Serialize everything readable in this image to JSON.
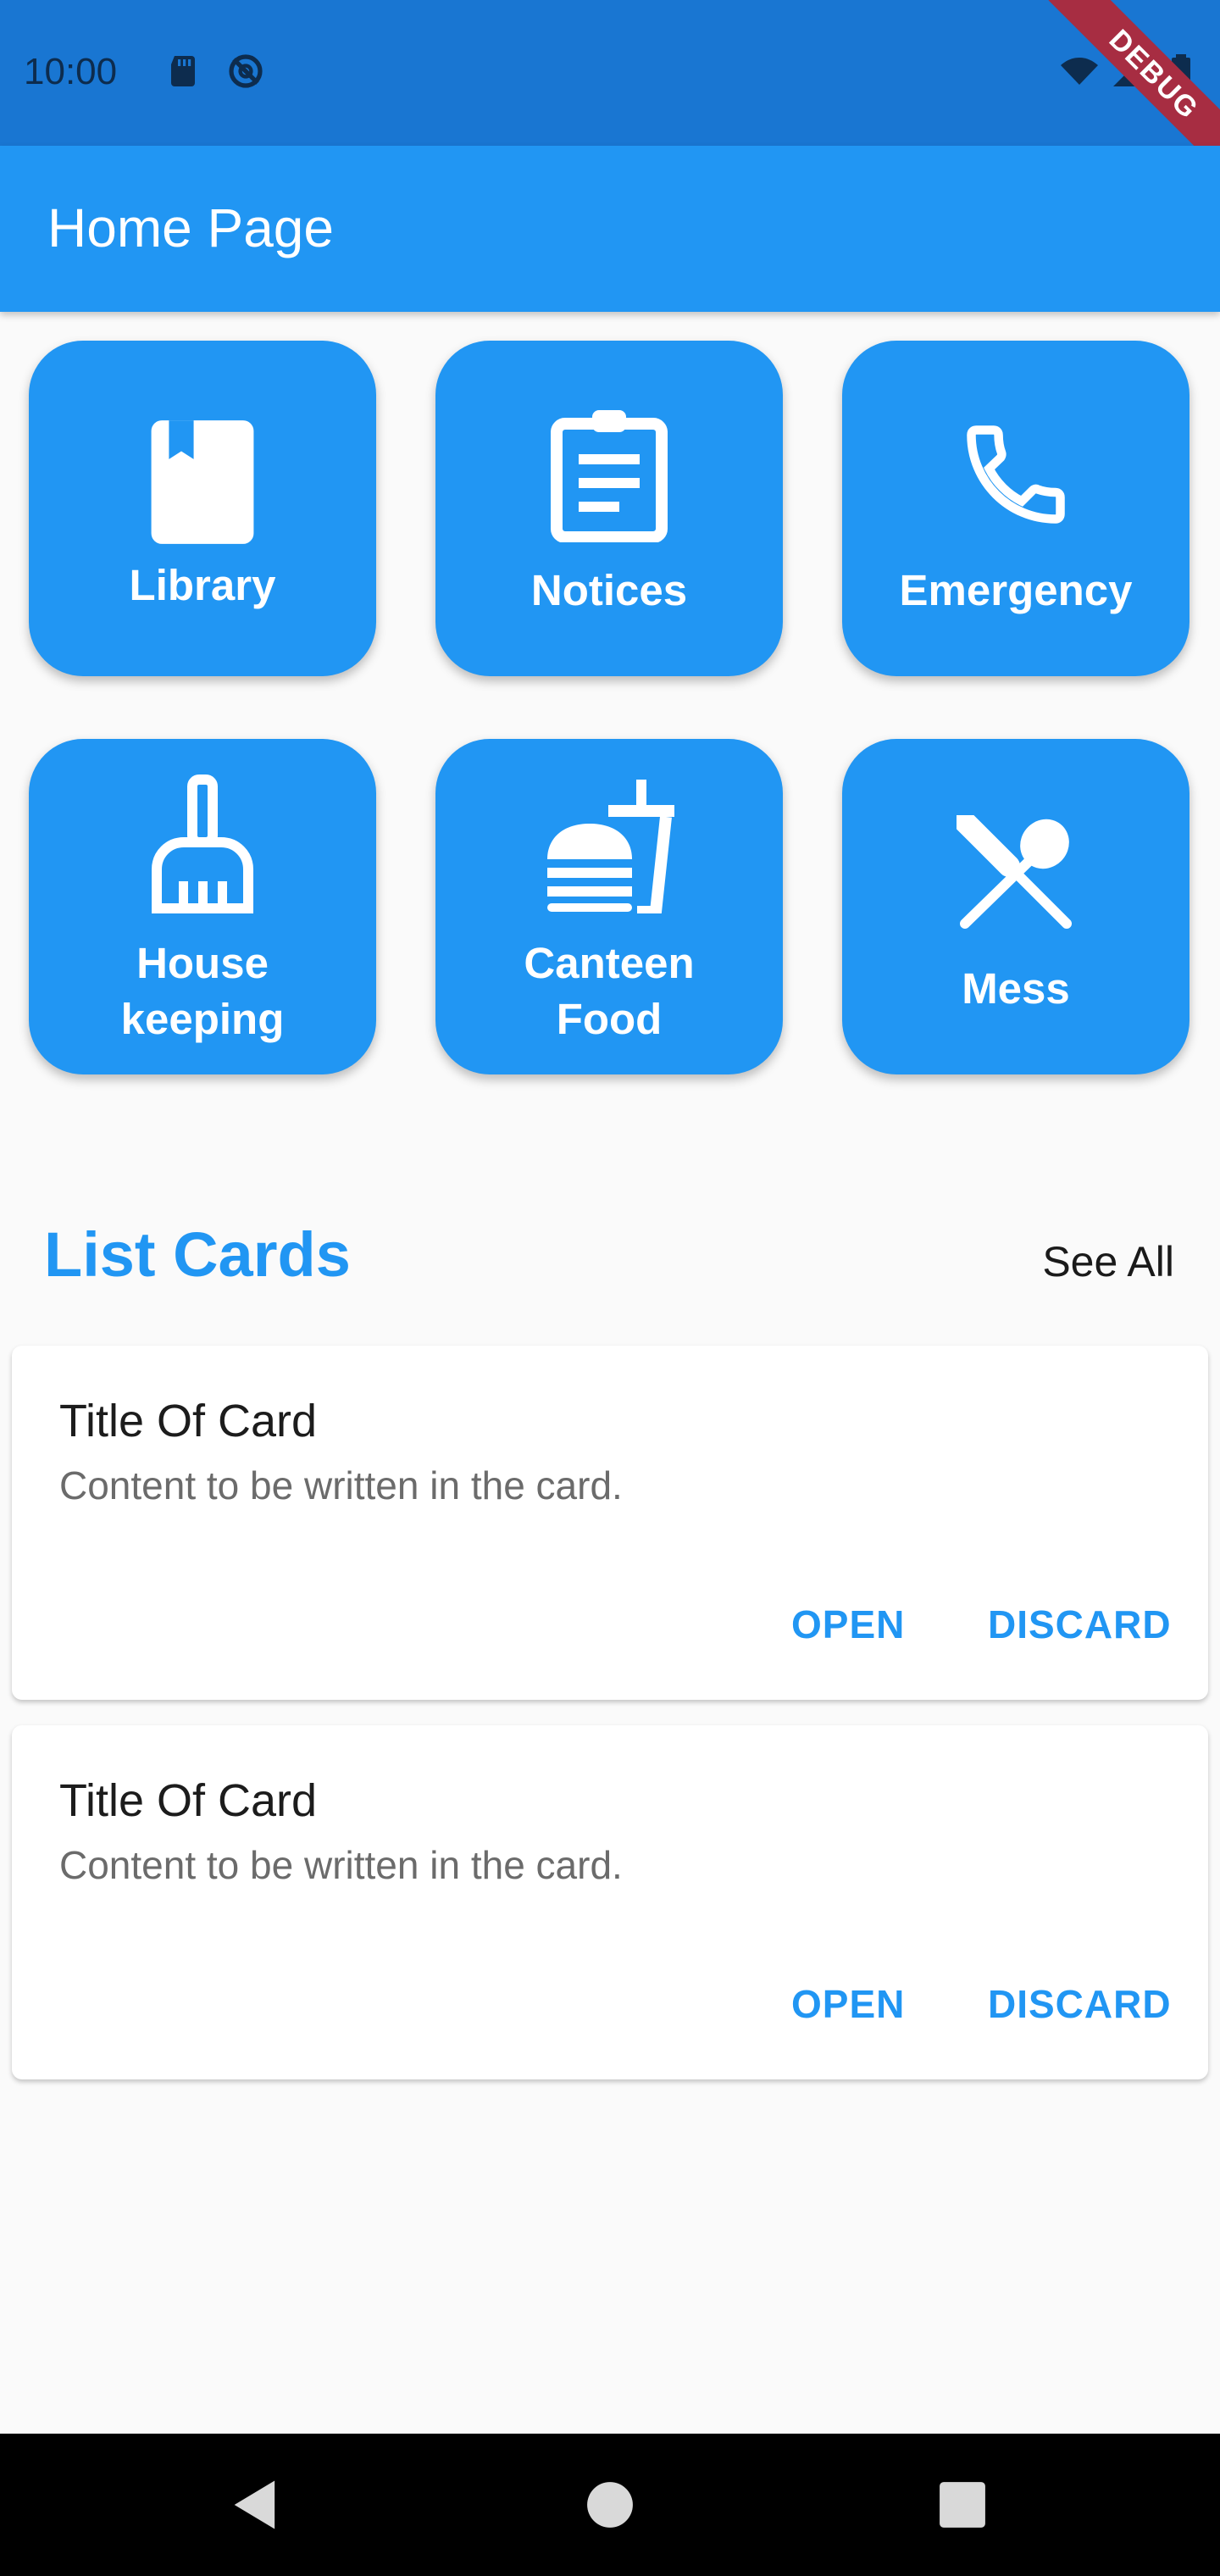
{
  "status_bar": {
    "time": "10:00",
    "icons": [
      "sd-card-icon",
      "sync-off-icon",
      "wifi-icon",
      "signal-icon",
      "battery-icon"
    ],
    "background": "#1976d2"
  },
  "debug_banner": {
    "label": "DEBUG",
    "color": "#a72d42"
  },
  "app_bar": {
    "title": "Home Page",
    "background": "#2196f3"
  },
  "tiles": [
    {
      "label": "Library",
      "icon": "book-icon"
    },
    {
      "label": "Notices",
      "icon": "clipboard-icon"
    },
    {
      "label": "Emergency",
      "icon": "phone-icon"
    },
    {
      "label_line1": "House",
      "label_line2": "keeping",
      "icon": "broom-icon"
    },
    {
      "label_line1": "Canteen",
      "label_line2": "Food",
      "icon": "fastfood-icon"
    },
    {
      "label": "Mess",
      "icon": "restaurant-icon"
    }
  ],
  "section": {
    "title": "List Cards",
    "see_all": "See All"
  },
  "cards": [
    {
      "title": "Title Of Card",
      "content": "Content to be written in the card.",
      "open": "OPEN",
      "discard": "DISCARD"
    },
    {
      "title": "Title Of Card",
      "content": "Content to be written in the card.",
      "open": "OPEN",
      "discard": "DISCARD"
    }
  ],
  "nav_bar": {
    "buttons": [
      "back-icon",
      "home-icon",
      "recents-icon"
    ]
  },
  "colors": {
    "accent": "#2196f3",
    "background": "#fafafa",
    "text": "#1c1c1c",
    "muted_text": "#6b6b6b"
  }
}
